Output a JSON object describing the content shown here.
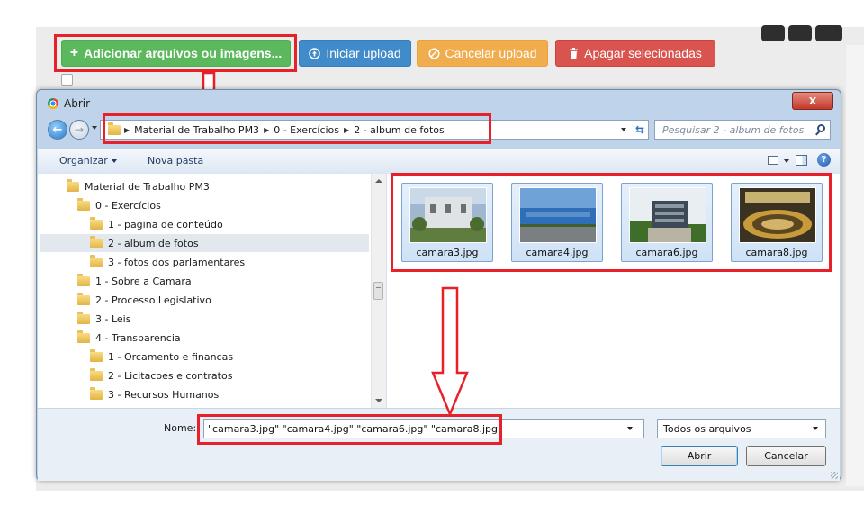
{
  "upload_toolbar": {
    "add_files_label": "Adicionar arquivos ou imagens...",
    "start_upload_label": "Iniciar upload",
    "cancel_upload_label": "Cancelar upload",
    "delete_selected_label": "Apagar selecionadas"
  },
  "dialog": {
    "title": "Abrir",
    "address": {
      "crumbs": [
        "Material de Trabalho PM3",
        "0 - Exercícios",
        "2 - album de fotos"
      ],
      "search_placeholder": "Pesquisar 2 - album de fotos"
    },
    "toolbar": {
      "organize_label": "Organizar",
      "new_folder_label": "Nova pasta"
    },
    "tree": [
      {
        "label": "Material de Trabalho PM3",
        "indent": 1,
        "selected": false
      },
      {
        "label": "0 - Exercícios",
        "indent": 2,
        "selected": false
      },
      {
        "label": "1 - pagina de conteúdo",
        "indent": 3,
        "selected": false
      },
      {
        "label": "2 - album de fotos",
        "indent": 3,
        "selected": true
      },
      {
        "label": "3 - fotos dos parlamentares",
        "indent": 3,
        "selected": false
      },
      {
        "label": "1 - Sobre a Camara",
        "indent": 2,
        "selected": false
      },
      {
        "label": "2 - Processo Legislativo",
        "indent": 2,
        "selected": false
      },
      {
        "label": "3 - Leis",
        "indent": 2,
        "selected": false
      },
      {
        "label": "4 - Transparencia",
        "indent": 2,
        "selected": false
      },
      {
        "label": "1 - Orcamento e financas",
        "indent": 3,
        "selected": false
      },
      {
        "label": "2 - Licitacoes e contratos",
        "indent": 3,
        "selected": false
      },
      {
        "label": "3 - Recursos Humanos",
        "indent": 3,
        "selected": false
      }
    ],
    "files": [
      {
        "name": "camara3.jpg"
      },
      {
        "name": "camara4.jpg"
      },
      {
        "name": "camara6.jpg"
      },
      {
        "name": "camara8.jpg"
      }
    ],
    "footer": {
      "name_label": "Nome:",
      "name_value": "\"camara3.jpg\" \"camara4.jpg\" \"camara6.jpg\" \"camara8.jpg\"",
      "file_type": "Todos os arquivos",
      "open_label": "Abrir",
      "cancel_label": "Cancelar"
    }
  },
  "colors": {
    "highlight": "#e8202a",
    "add_button": "#5cb85c",
    "start_button": "#428bca",
    "cancel_button": "#f0ad4e",
    "delete_button": "#d9534f"
  }
}
